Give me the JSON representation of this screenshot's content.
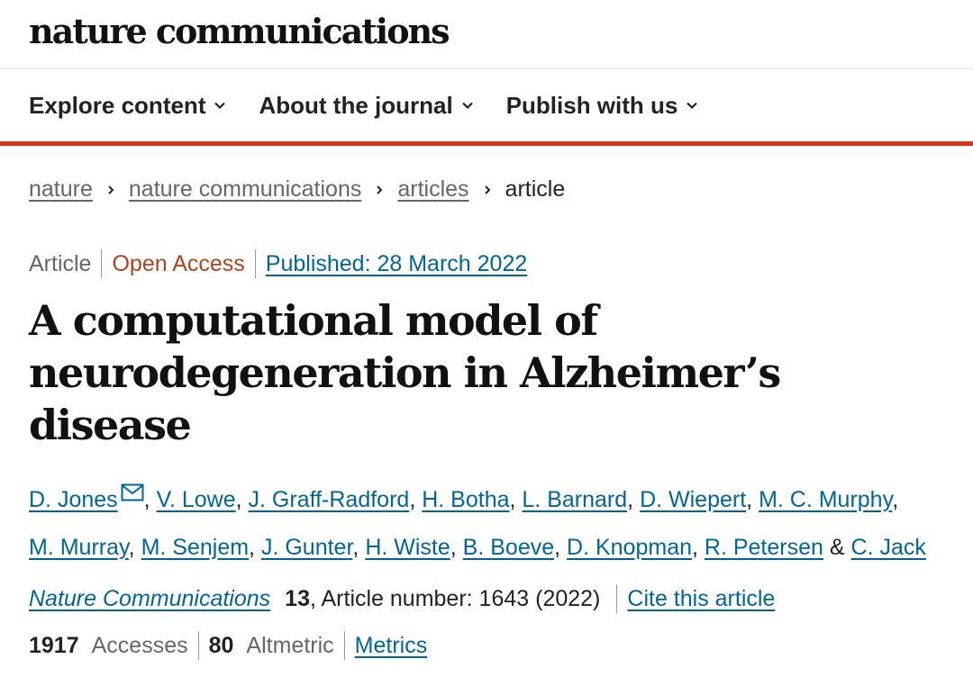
{
  "site": {
    "logo_text": "nature communications"
  },
  "nav": {
    "items": [
      {
        "label": "Explore content"
      },
      {
        "label": "About the journal"
      },
      {
        "label": "Publish with us"
      }
    ]
  },
  "breadcrumb": {
    "items": [
      "nature",
      "nature communications",
      "articles",
      "article"
    ]
  },
  "article": {
    "type": "Article",
    "access": "Open Access",
    "published": "Published: 28 March 2022",
    "title_line1": "A computational model of",
    "title_line2": "neurodegeneration in Alzheimer’s disease",
    "authors": [
      "D. Jones",
      "V. Lowe",
      "J. Graff-Radford",
      "H. Botha",
      "L. Barnard",
      "D. Wiepert",
      "M. C. Murphy",
      "M. Murray",
      "M. Senjem",
      "J. Gunter",
      "H. Wiste",
      "B. Boeve",
      "D. Knopman",
      "R. Petersen",
      "C. Jack"
    ],
    "authors_conjunction": "&",
    "comma": ",",
    "journal": "Nature Communications",
    "volume": "13",
    "article_number_text": ", Article number: 1643 (2022)",
    "cite_label": "Cite this article",
    "accesses_value": "1917",
    "accesses_label": "Accesses",
    "altmetric_value": "80",
    "altmetric_label": "Altmetric",
    "metrics_label": "Metrics"
  },
  "colors": {
    "accent_red": "#e0301e",
    "link_blue": "#006699",
    "open_access_orange": "#b0431e"
  }
}
